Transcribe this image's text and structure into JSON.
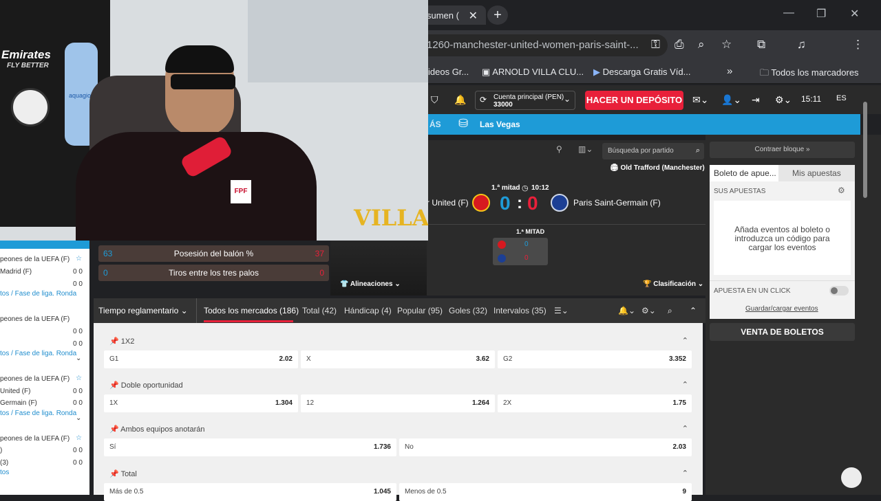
{
  "tab": {
    "title": "sumen (",
    "close": "✕",
    "new": "+"
  },
  "window": {
    "min": "—",
    "max": "❐",
    "close": "✕"
  },
  "address": {
    "url": "1260-manchester-united-women-paris-saint-..."
  },
  "bookmarks": [
    {
      "label": "ideos Gr..."
    },
    {
      "label": "ARNOLD VILLA CLU..."
    },
    {
      "label": "Descarga Gratis Víd..."
    },
    {
      "label": "»"
    },
    {
      "label": "Todos los marcadores"
    }
  ],
  "header": {
    "account_label": "Cuenta principal (PEN)",
    "account_value": "33000",
    "deposit": "HACER UN DEPÓSITO",
    "time": "15:11",
    "lang": "ES"
  },
  "nav": {
    "mas": "ÁS",
    "vegas": "Las Vegas"
  },
  "event": {
    "search_placeholder": "Búsqueda por partido",
    "venue": "Old Trafford (Manchester)",
    "period": "1.ª mitad",
    "clock": "10:12",
    "home": "r United (F)",
    "away": "Paris Saint-Germain (F)",
    "home_score": "0",
    "away_score": "0",
    "sep": ":",
    "half_label": "1.ª MITAD",
    "home_half": "0",
    "away_half": "0",
    "lineups": "Alineaciones",
    "standings": "Clasificación"
  },
  "stats": [
    {
      "home": "63",
      "label": "Posesión del balón %",
      "away": "37"
    },
    {
      "home": "0",
      "label": "Tiros entre los tres palos",
      "away": "0"
    }
  ],
  "right": {
    "collapse": "Contraer bloque »",
    "tab_slip": "Boleto de apue...",
    "tab_bets": "Mis apuestas",
    "your_bets": "SUS APUESTAS",
    "empty_msg": "Añada eventos al boleto o introduzca un código para cargar los eventos",
    "one_click": "APUESTA EN UN CLICK",
    "save_load": "Guardar/cargar eventos",
    "sell": "VENTA DE BOLETOS"
  },
  "market_tabs": {
    "period": "Tiempo reglamentario",
    "tabs": [
      "Todos los mercados (186)",
      "Total (42)",
      "Hándicap (4)",
      "Popular (95)",
      "Goles (32)",
      "Intervalos (35)"
    ]
  },
  "markets": [
    {
      "title": "1X2",
      "odds": [
        {
          "l": "G1",
          "v": "2.02"
        },
        {
          "l": "X",
          "v": "3.62"
        },
        {
          "l": "G2",
          "v": "3.352"
        }
      ]
    },
    {
      "title": "Doble oportunidad",
      "odds": [
        {
          "l": "1X",
          "v": "1.304"
        },
        {
          "l": "12",
          "v": "1.264"
        },
        {
          "l": "2X",
          "v": "1.75"
        }
      ]
    },
    {
      "title": "Ambos equipos anotarán",
      "odds": [
        {
          "l": "Sí",
          "v": "1.736"
        },
        {
          "l": "No",
          "v": "2.03"
        }
      ]
    },
    {
      "title": "Total",
      "odds": [
        {
          "l": "Más de 0.5",
          "v": "1.045"
        },
        {
          "l": "Menos de 0.5",
          "v": "9"
        }
      ]
    }
  ],
  "leftlist": {
    "l1": "peones de la UEFA (F)",
    "l2": "Madrid (F)",
    "l3": "tos / Fase de liga. Ronda",
    "l4": "peones de la UEFA (F)",
    "l5": "tos / Fase de liga. Ronda",
    "l6": "peones de la UEFA (F)",
    "l7": "United (F)",
    "l8": "Germain (F)",
    "l9": "tos / Fase de liga. Ronda",
    "l10": "peones de la UEFA (F)",
    "l11": ")",
    "l12": "(3)",
    "l13": "tos",
    "zero": "0 0"
  },
  "webcam": {
    "logo": "VILLA",
    "shirt": "FPF",
    "brand": "Emirates",
    "brand2": "FLY BETTER",
    "water": "aquagio"
  }
}
